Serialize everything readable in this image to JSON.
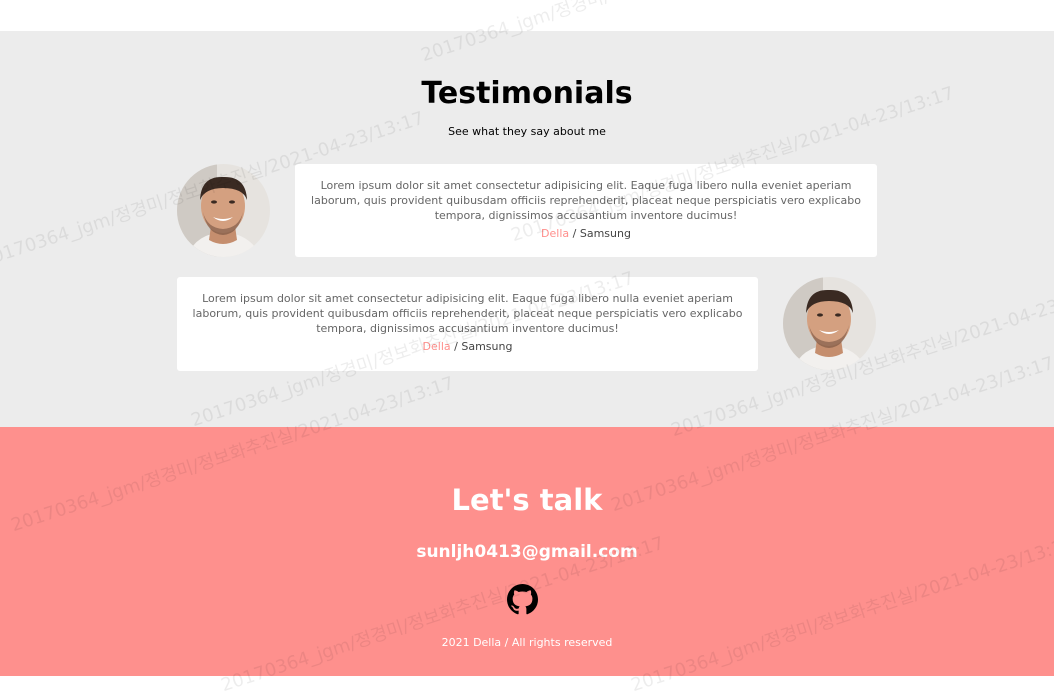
{
  "testimonials": {
    "title": "Testimonials",
    "subtitle": "See what they say about me",
    "items": [
      {
        "text": "Lorem ipsum dolor sit amet consectetur adipisicing elit. Eaque fuga libero nulla eveniet aperiam laborum, quis provident quibusdam officiis reprehenderit, placeat neque perspiciatis vero explicabo tempora, dignissimos accusantium inventore ducimus!",
        "name": "Della",
        "separator": " / ",
        "company": "Samsung"
      },
      {
        "text": "Lorem ipsum dolor sit amet consectetur adipisicing elit. Eaque fuga libero nulla eveniet aperiam laborum, quis provident quibusdam officiis reprehenderit, placeat neque perspiciatis vero explicabo tempora, dignissimos accusantium inventore ducimus!",
        "name": "Della",
        "separator": " / ",
        "company": "Samsung"
      }
    ]
  },
  "contact": {
    "title": "Let's talk",
    "email": "sunljh0413@gmail.com",
    "icon": "github-icon",
    "copyright": "2021 Della / All rights reserved"
  },
  "watermark": {
    "text": "20170364_jgm/정경미/정보화추진실/2021-04-23/13:17"
  },
  "colors": {
    "accent": "#fe908d",
    "name_accent": "#ff8f8c",
    "section_bg": "#ececec"
  }
}
